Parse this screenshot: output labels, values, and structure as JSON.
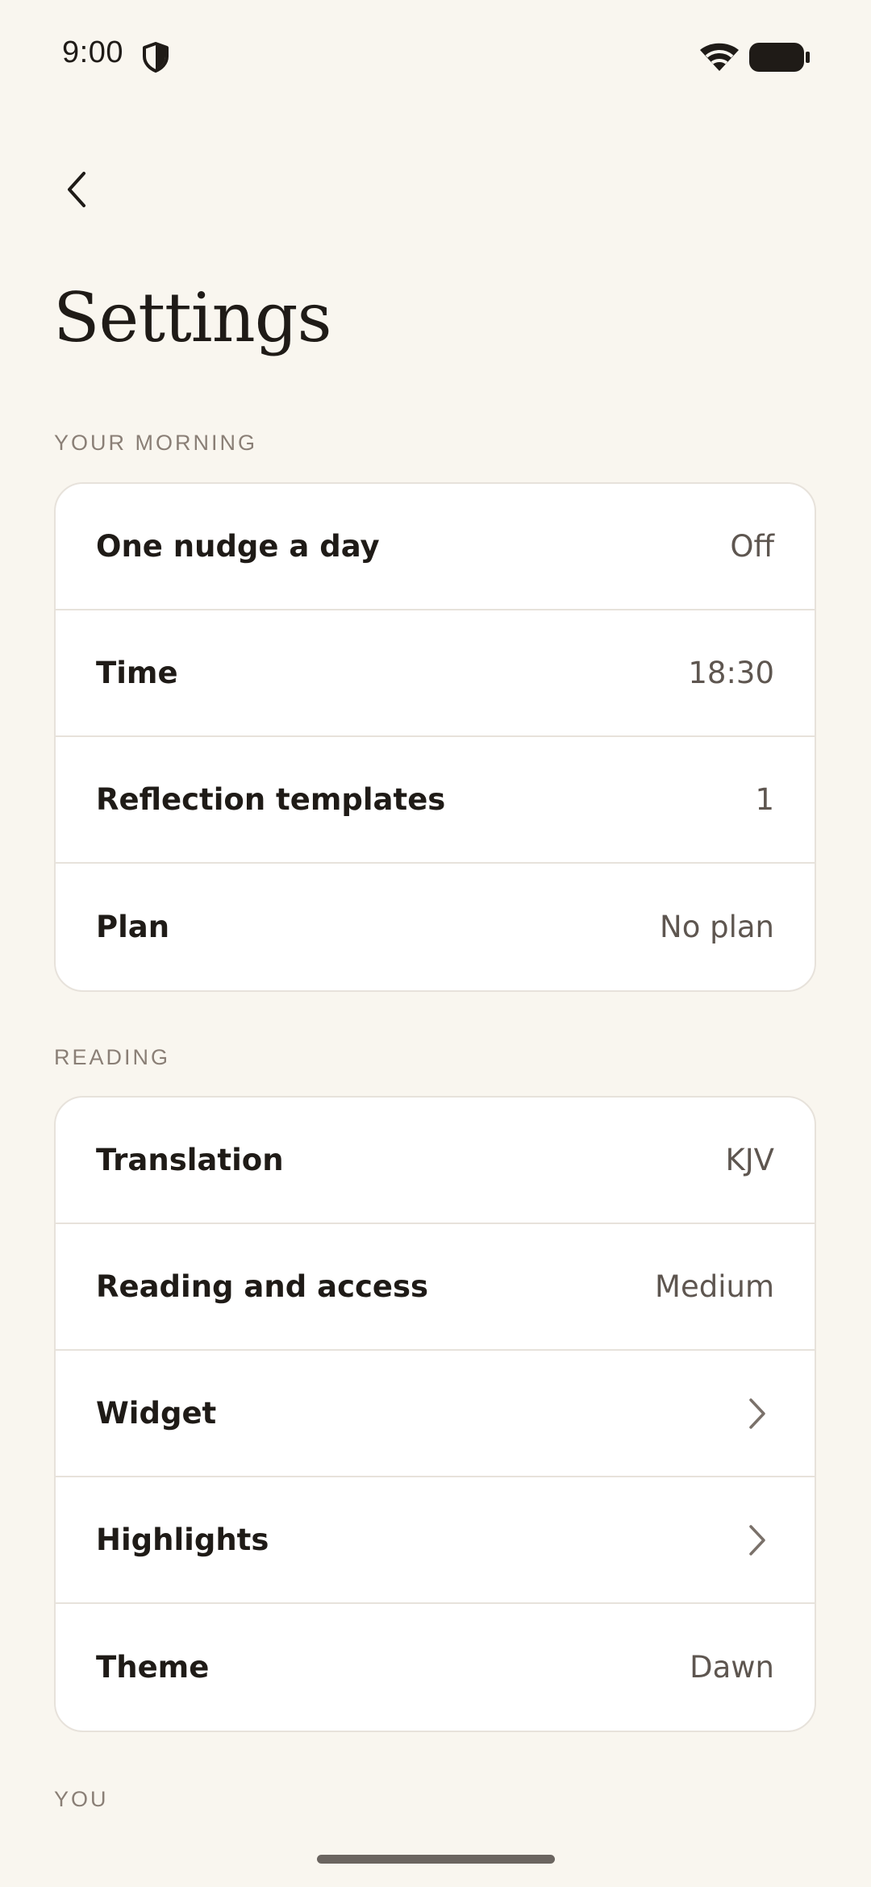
{
  "status_bar": {
    "time": "9:00",
    "icons": [
      "shield-icon",
      "wifi-icon",
      "battery-icon"
    ]
  },
  "header": {
    "back_icon": "chevron-left-icon",
    "title": "Settings"
  },
  "sections": [
    {
      "title": "YOUR MORNING",
      "rows": [
        {
          "label": "One nudge a day",
          "value": "Off"
        },
        {
          "label": "Time",
          "value": "18:30"
        },
        {
          "label": "Reflection templates",
          "value": "1"
        },
        {
          "label": "Plan",
          "value": "No plan"
        }
      ]
    },
    {
      "title": "READING",
      "rows": [
        {
          "label": "Translation",
          "value": "KJV"
        },
        {
          "label": "Reading and access",
          "value": "Medium"
        },
        {
          "label": "Widget",
          "icon": "chevron-right-icon"
        },
        {
          "label": "Highlights",
          "icon": "chevron-right-icon"
        },
        {
          "label": "Theme",
          "value": "Dawn"
        }
      ]
    },
    {
      "title": "YOU",
      "rows": []
    }
  ],
  "colors": {
    "background": "#f9f6ef",
    "card": "#ffffff",
    "divider": "#e7e2db",
    "text_primary": "#1f1b17",
    "text_secondary": "#5e5650",
    "section_header": "#8a7f76"
  }
}
